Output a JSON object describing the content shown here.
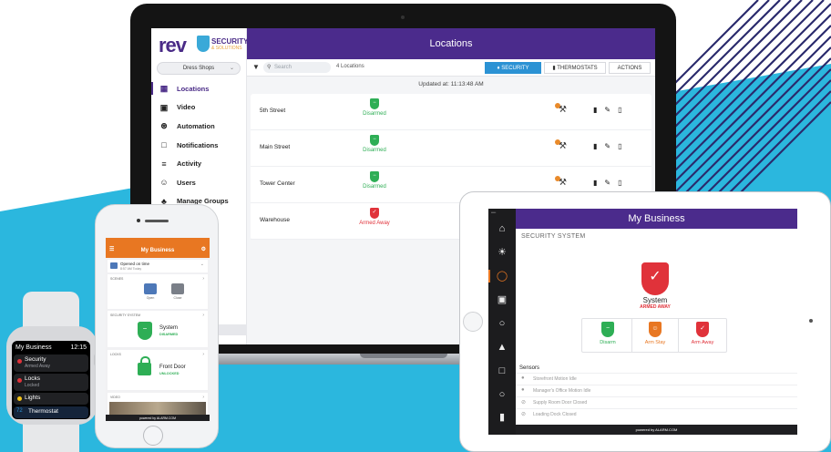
{
  "colors": {
    "brand_purple": "#4b2b8c",
    "security_blue": "#2b92d4",
    "disarmed_green": "#2eae55",
    "armed_red": "#e0323a",
    "app_orange": "#e87722",
    "background_cyan": "#2bb7de"
  },
  "laptop": {
    "logo": {
      "brand": "rev",
      "product": "SECURITY",
      "product_sub": "& SOLUTIONS"
    },
    "account_select": "Dress Shops",
    "nav": [
      {
        "label": "Locations",
        "icon": "building-icon",
        "active": true
      },
      {
        "label": "Video",
        "icon": "video-camera-icon"
      },
      {
        "label": "Automation",
        "icon": "automation-icon"
      },
      {
        "label": "Notifications",
        "icon": "notification-icon"
      },
      {
        "label": "Activity",
        "icon": "activity-icon"
      },
      {
        "label": "Users",
        "icon": "users-icon"
      },
      {
        "label": "Manage Groups",
        "icon": "groups-icon"
      }
    ],
    "header_title": "Locations",
    "toolbar": {
      "search_placeholder": "Search",
      "count": "4 Locations",
      "tabs": [
        "SECURITY",
        "THERMOSTATS",
        "ACTIONS"
      ]
    },
    "updated": "Updated at: 11:13:48 AM",
    "rows": [
      {
        "name": "5th Street",
        "status": "Disarmed",
        "state": "disarmed"
      },
      {
        "name": "Main Street",
        "status": "Disarmed",
        "state": "disarmed"
      },
      {
        "name": "Tower Center",
        "status": "Disarmed",
        "state": "disarmed"
      },
      {
        "name": "Warehouse",
        "status": "Armed Away",
        "state": "armed"
      }
    ]
  },
  "watch": {
    "title": "My Business",
    "time": "12:15",
    "items": [
      {
        "label": "Security",
        "sub": "Armed Away",
        "dot": "#e0323a"
      },
      {
        "label": "Locks",
        "sub": "Locked",
        "dot": "#e0323a"
      },
      {
        "label": "Lights",
        "sub": "",
        "dot": "#f5c518"
      },
      {
        "label": "Thermostat",
        "sub": "",
        "dot": "#2b92d4",
        "prefix": "72"
      }
    ]
  },
  "phone": {
    "title": "My Business",
    "opened": {
      "title": "Opened on time",
      "sub": "8:57 AM Today"
    },
    "scenes_caption": "SCENES",
    "scenes": [
      "Open",
      "Close"
    ],
    "security_caption": "SECURITY SYSTEM",
    "security_title": "System",
    "security_status": "DISARMED",
    "locks_caption": "LOCKS",
    "lock_title": "Front Door",
    "lock_status": "UNLOCKED",
    "video_caption": "VIDEO",
    "footer": "powered by ALARM.COM"
  },
  "tablet": {
    "title": "My Business",
    "section": "SECURITY SYSTEM",
    "system_title": "System",
    "system_status": "ARMED AWAY",
    "buttons": [
      {
        "label": "Disarm",
        "color": "#2eae55"
      },
      {
        "label": "Arm Stay",
        "color": "#e87722"
      },
      {
        "label": "Arm Away",
        "color": "#e0323a"
      }
    ],
    "sensors_title": "Sensors",
    "sensors": [
      "Storefront Motion Idle",
      "Manager's Office Motion Idle",
      "Supply Room Door Closed",
      "Loading Dock Closed"
    ],
    "rail_icons": [
      "home-icon",
      "weather-icon",
      "shield-icon",
      "image-icon",
      "lock-icon",
      "garage-icon",
      "video-camera-icon",
      "lightbulb-icon",
      "thermostat-icon"
    ],
    "footer": "powered by ALARM.COM"
  }
}
